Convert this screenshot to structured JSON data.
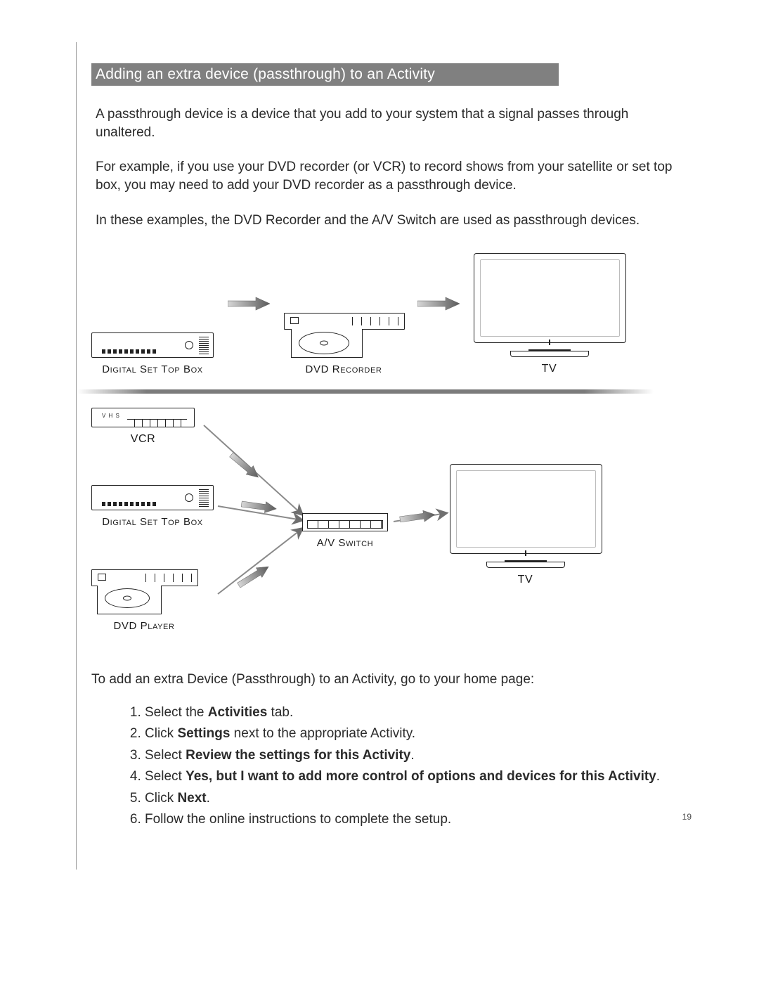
{
  "heading": "Adding an extra device (passthrough) to an Activity",
  "para1": "A passthrough device is a device that you add to your system that a signal passes through unaltered.",
  "para2": "For example,  if you use your DVD recorder (or VCR) to record shows from your satellite or set top box, you may need to add your DVD recorder as a passthrough device.",
  "para3": "In these examples, the DVD Recorder and the A/V Switch are used as passthrough devices.",
  "diagram": {
    "top": {
      "stb": "Digital Set Top Box",
      "dvdr": "DVD Recorder",
      "tv": "TV"
    },
    "bottom": {
      "vcr": "VCR",
      "vcr_panel": "V H S",
      "stb": "Digital Set Top Box",
      "dvdp": "DVD Player",
      "switch": "A/V Switch",
      "tv": "TV"
    }
  },
  "intro_steps": "To add an extra Device (Passthrough) to an Activity, go to your home page:",
  "steps": {
    "s1a": "Select the ",
    "s1b": "Activities",
    "s1c": " tab.",
    "s2a": "Click ",
    "s2b": "Settings",
    "s2c": " next to the appropriate Activity.",
    "s3a": "Select ",
    "s3b": "Review the settings for this Activity",
    "s3c": ".",
    "s4a": "Select ",
    "s4b": "Yes, but I want to add more control of options and devices for this Activity",
    "s4c": ".",
    "s5a": "Click ",
    "s5b": "Next",
    "s5c": ".",
    "s6": "Follow the online instructions to complete the setup."
  },
  "page_number": "19"
}
